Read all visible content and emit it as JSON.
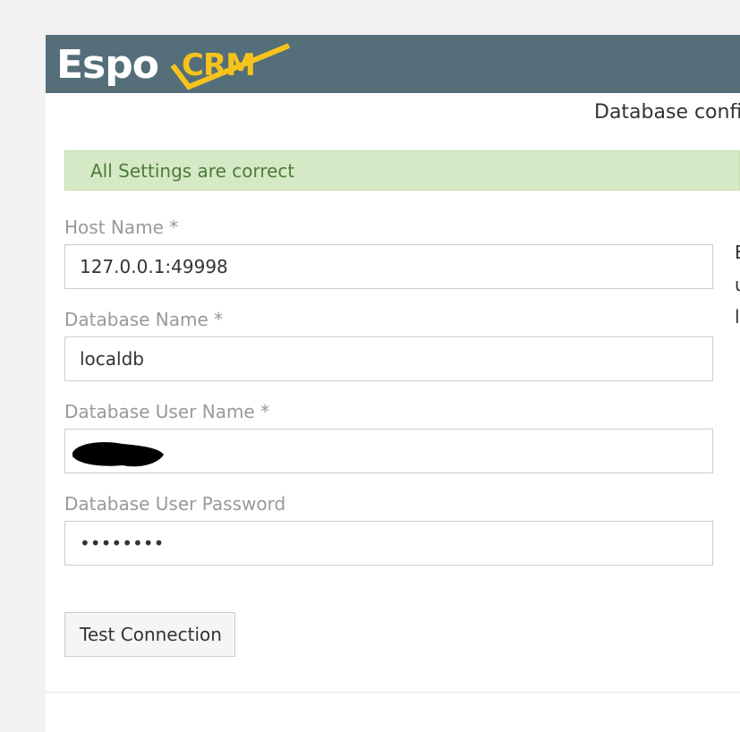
{
  "header": {
    "logo_text_espo": "Espo",
    "logo_text_crm": "CRM",
    "brand_color": "#546e7a",
    "accent_color": "#f5c31b"
  },
  "page": {
    "title": "Database config"
  },
  "alert": {
    "message": "All Settings are correct",
    "color": "#d6e9c6"
  },
  "form": {
    "host_name": {
      "label": "Host Name *",
      "value": "127.0.0.1:49998"
    },
    "database_name": {
      "label": "Database Name *",
      "value": "localdb"
    },
    "database_user_name": {
      "label": "Database User Name *",
      "value": ""
    },
    "database_user_password": {
      "label": "Database User Password",
      "value": "••••••••"
    }
  },
  "actions": {
    "test_connection_label": "Test Connection"
  },
  "side_text": {
    "line1": "E",
    "line2": "u",
    "line3": "l"
  }
}
